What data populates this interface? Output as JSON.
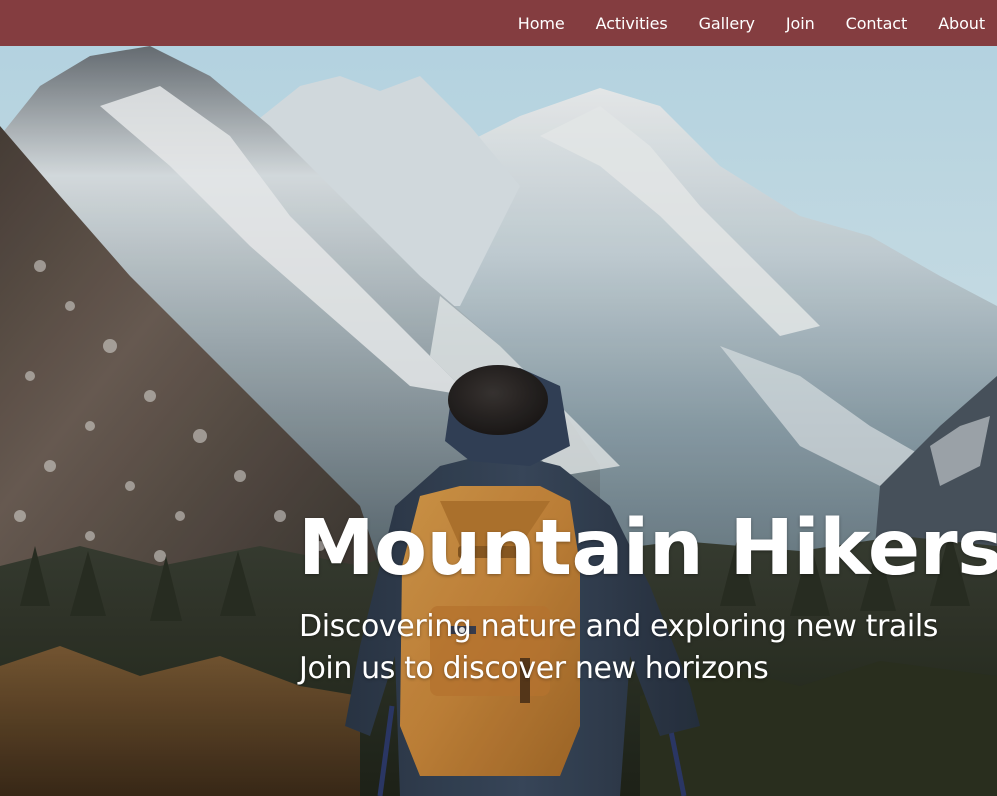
{
  "nav": {
    "items": [
      {
        "label": "Home"
      },
      {
        "label": "Activities"
      },
      {
        "label": "Gallery"
      },
      {
        "label": "Join"
      },
      {
        "label": "Contact"
      },
      {
        "label": "About"
      }
    ]
  },
  "hero": {
    "image": "mountain-hiker-photo",
    "title": "Mountain Hikers",
    "subtitle": "Discovering nature and exploring new trails",
    "tagline": "Join us to discover new horizons"
  },
  "colors": {
    "navbar_background": "#843d40",
    "nav_text": "#ffffff",
    "hero_text": "#ffffff"
  }
}
